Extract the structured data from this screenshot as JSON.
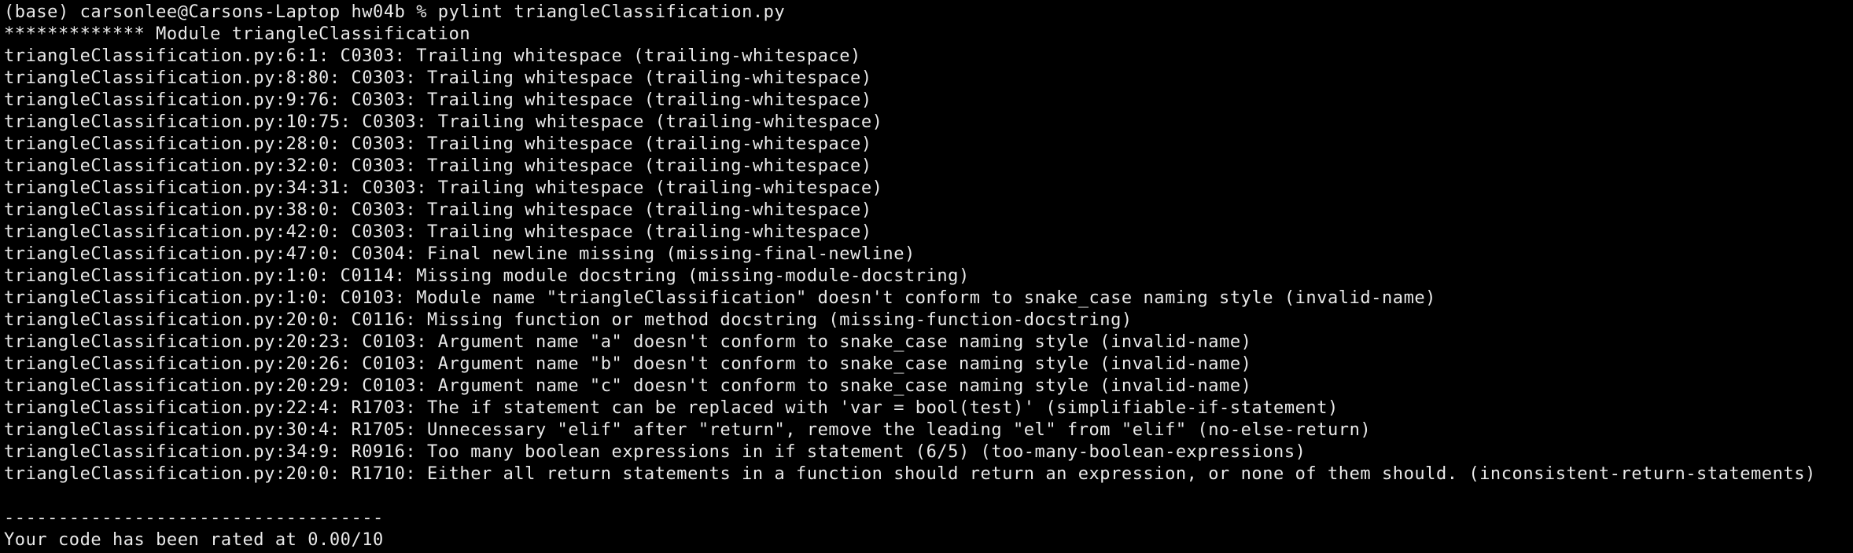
{
  "terminal": {
    "prompt": "(base) carsonlee@Carsons-Laptop hw04b % pylint triangleClassification.py",
    "module_header": "************* Module triangleClassification",
    "messages": [
      "triangleClassification.py:6:1: C0303: Trailing whitespace (trailing-whitespace)",
      "triangleClassification.py:8:80: C0303: Trailing whitespace (trailing-whitespace)",
      "triangleClassification.py:9:76: C0303: Trailing whitespace (trailing-whitespace)",
      "triangleClassification.py:10:75: C0303: Trailing whitespace (trailing-whitespace)",
      "triangleClassification.py:28:0: C0303: Trailing whitespace (trailing-whitespace)",
      "triangleClassification.py:32:0: C0303: Trailing whitespace (trailing-whitespace)",
      "triangleClassification.py:34:31: C0303: Trailing whitespace (trailing-whitespace)",
      "triangleClassification.py:38:0: C0303: Trailing whitespace (trailing-whitespace)",
      "triangleClassification.py:42:0: C0303: Trailing whitespace (trailing-whitespace)",
      "triangleClassification.py:47:0: C0304: Final newline missing (missing-final-newline)",
      "triangleClassification.py:1:0: C0114: Missing module docstring (missing-module-docstring)",
      "triangleClassification.py:1:0: C0103: Module name \"triangleClassification\" doesn't conform to snake_case naming style (invalid-name)",
      "triangleClassification.py:20:0: C0116: Missing function or method docstring (missing-function-docstring)",
      "triangleClassification.py:20:23: C0103: Argument name \"a\" doesn't conform to snake_case naming style (invalid-name)",
      "triangleClassification.py:20:26: C0103: Argument name \"b\" doesn't conform to snake_case naming style (invalid-name)",
      "triangleClassification.py:20:29: C0103: Argument name \"c\" doesn't conform to snake_case naming style (invalid-name)",
      "triangleClassification.py:22:4: R1703: The if statement can be replaced with 'var = bool(test)' (simplifiable-if-statement)",
      "triangleClassification.py:30:4: R1705: Unnecessary \"elif\" after \"return\", remove the leading \"el\" from \"elif\" (no-else-return)",
      "triangleClassification.py:34:9: R0916: Too many boolean expressions in if statement (6/5) (too-many-boolean-expressions)",
      "triangleClassification.py:20:0: R1710: Either all return statements in a function should return an expression, or none of them should. (inconsistent-return-statements)"
    ],
    "separator": "-----------------------------------",
    "rating": "Your code has been rated at 0.00/10"
  },
  "colors": {
    "background": "#000000",
    "foreground": "#e9e9e9"
  }
}
